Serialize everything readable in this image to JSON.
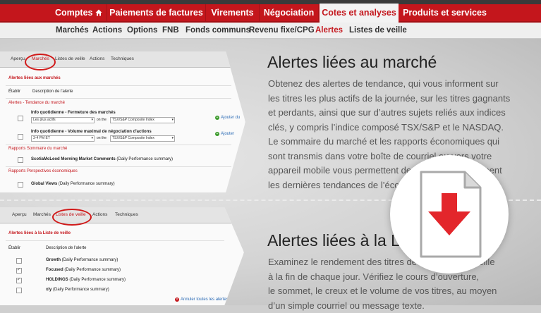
{
  "main_nav": [
    {
      "label": "Comptes",
      "icon": "home-icon"
    },
    {
      "label": "Paiements de factures"
    },
    {
      "label": "Virements"
    },
    {
      "label": "Négociation"
    },
    {
      "label": "Cotes et analyses",
      "active": true
    },
    {
      "label": "Produits et services"
    }
  ],
  "sub_nav": [
    "Marchés",
    "Actions",
    "Options",
    "FNB",
    "Fonds communs",
    "Revenu fixe/CPG",
    "Alertes",
    "Listes de veille"
  ],
  "sub_nav_active": "Alertes",
  "panel1": {
    "tabs": [
      "Aperçu",
      "Marchés",
      "Listes de veille",
      "Actions",
      "Techniques"
    ],
    "heading": "Alertes liées aux marchés",
    "col_establish": "Établir",
    "col_desc": "Description de l'alerte",
    "section_trend": "Alertes - Tendance du marché",
    "alert1_title": "Info quotidienne - Fermeture des marchés",
    "alert1_select": "Les plus actifs",
    "on_the": "on the",
    "index_select": "TSX/S&P Composite Index",
    "add_label": "Ajouter du",
    "alert2_title": "Info quotidienne - Volume maximal de négociation d'actions",
    "alert2_select": "3-4 PM ET",
    "add_label2": "Ajouter",
    "section_summary": "Rapports Sommaire du marché",
    "summary_item": "ScotiaMcLeod Morning Market Comments",
    "daily_summary": "(Daily Performance summary)",
    "section_outlook": "Rapports Perspectives économiques",
    "outlook_item": "Global Views"
  },
  "panel2": {
    "tabs": [
      "Aperçu",
      "Marchés",
      "Listes de veille",
      "Actions",
      "Techniques"
    ],
    "heading": "Alertes liées à la Liste de veille",
    "col_establish": "Établir",
    "col_desc": "Description de l'alerte",
    "items": [
      {
        "name": "Growth",
        "checked": false
      },
      {
        "name": "Focused",
        "checked": true
      },
      {
        "name": "HOLDINGS",
        "checked": true
      },
      {
        "name": "xly",
        "checked": false
      }
    ],
    "daily_summary": "(Daily Performance summary)",
    "cancel_all": "Annuler toutes les alertes"
  },
  "section1": {
    "title": "Alertes liées au marché",
    "lines": [
      "Obtenez des alertes de tendance, qui vous informent sur",
      "les titres les plus actifs de la journée, sur les titres gagnants",
      "et perdants, ainsi que sur d’autres sujets reliés aux indices",
      "clés, y compris l’indice composé TSX/S&P et le NASDAQ.",
      "Le sommaire du marché et les rapports économiques qui",
      "sont transmis dans votre boîte de courriel ou vers votre",
      "appareil mobile vous permettent de connaître instamment",
      "les dernières tendances de l’économie."
    ]
  },
  "section2": {
    "title": "Alertes liées à la Liste de veille",
    "lines": [
      "Examinez le rendement des titres de votre liste de veille",
      "à la fin de chaque jour. Vérifiez le cours d’ouverture,",
      "le sommet, le creux et le volume de vos titres, au moyen",
      "d’un simple courriel ou message texte."
    ]
  },
  "colors": {
    "brand_red": "#c4161c",
    "download_arrow": "#e3262b"
  }
}
